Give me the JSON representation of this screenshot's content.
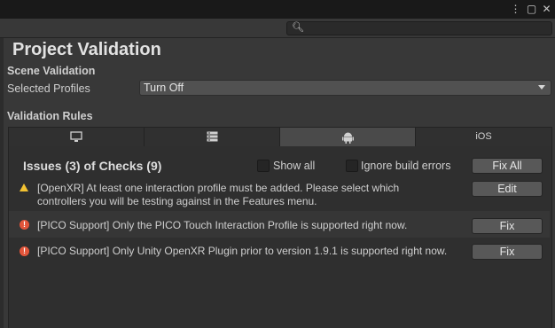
{
  "window": {
    "menu_icon": "⋮",
    "maximize_icon": "▢",
    "close_icon": "✕"
  },
  "search": {
    "placeholder": ""
  },
  "page": {
    "title": "Project Validation"
  },
  "scene_validation": {
    "heading": "Scene Validation",
    "profiles_label": "Selected Profiles",
    "profiles_value": "Turn Off"
  },
  "validation_rules": {
    "heading": "Validation Rules",
    "tabs": [
      {
        "icon": "monitor-icon",
        "label": ""
      },
      {
        "icon": "server-icon",
        "label": ""
      },
      {
        "icon": "android-icon",
        "label": ""
      },
      {
        "icon": "ios-label",
        "label": "iOS"
      }
    ]
  },
  "issues": {
    "heading": "Issues (3) of Checks (9)",
    "show_all_label": "Show all",
    "ignore_errors_label": "Ignore build errors",
    "fix_all_label": "Fix All",
    "rows": [
      {
        "severity": "warning",
        "text": "[OpenXR] At least one interaction profile must be added.  Please select which controllers you will be testing against in the Features menu.",
        "action": "Edit"
      },
      {
        "severity": "error",
        "text": "[PICO Support] Only the PICO Touch Interaction Profile is supported right now.",
        "action": "Fix"
      },
      {
        "severity": "error",
        "text": "[PICO Support] Only Unity OpenXR Plugin prior to version 1.9.1 is supported right now.",
        "action": "Fix"
      }
    ]
  },
  "colors": {
    "background": "#383838",
    "warning": "#f2c232",
    "error": "#e2553a"
  }
}
